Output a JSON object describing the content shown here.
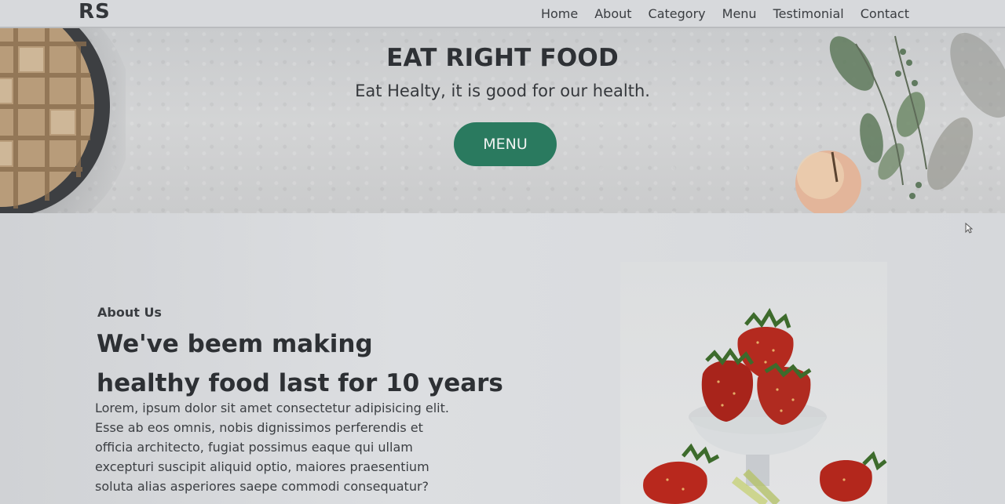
{
  "navbar": {
    "logo": "RS",
    "links": [
      "Home",
      "About",
      "Category",
      "Menu",
      "Testimonial",
      "Contact"
    ]
  },
  "hero": {
    "title": "EAT RIGHT FOOD",
    "subtitle": "Eat Healty, it is good for our health.",
    "button_label": "MENU"
  },
  "about": {
    "kicker": "About Us",
    "heading_lines": [
      "We've beem making",
      "healthy food last for 10 years"
    ],
    "body_lines": [
      "Lorem, ipsum dolor sit amet consectetur adipisicing elit.",
      "Esse ab eos omnis, nobis dignissimos perferendis et",
      "officia architecto, fugiat possimus eaque qui ullam",
      "excepturi suscipit aliquid optio, maiores praesentium",
      "soluta alias asperiores saepe commodi consequatur?"
    ]
  },
  "colors": {
    "accent": "#2a7a5f",
    "text_dark": "#2d3034"
  },
  "icons": {
    "cursor": "pointer-cursor-icon"
  }
}
